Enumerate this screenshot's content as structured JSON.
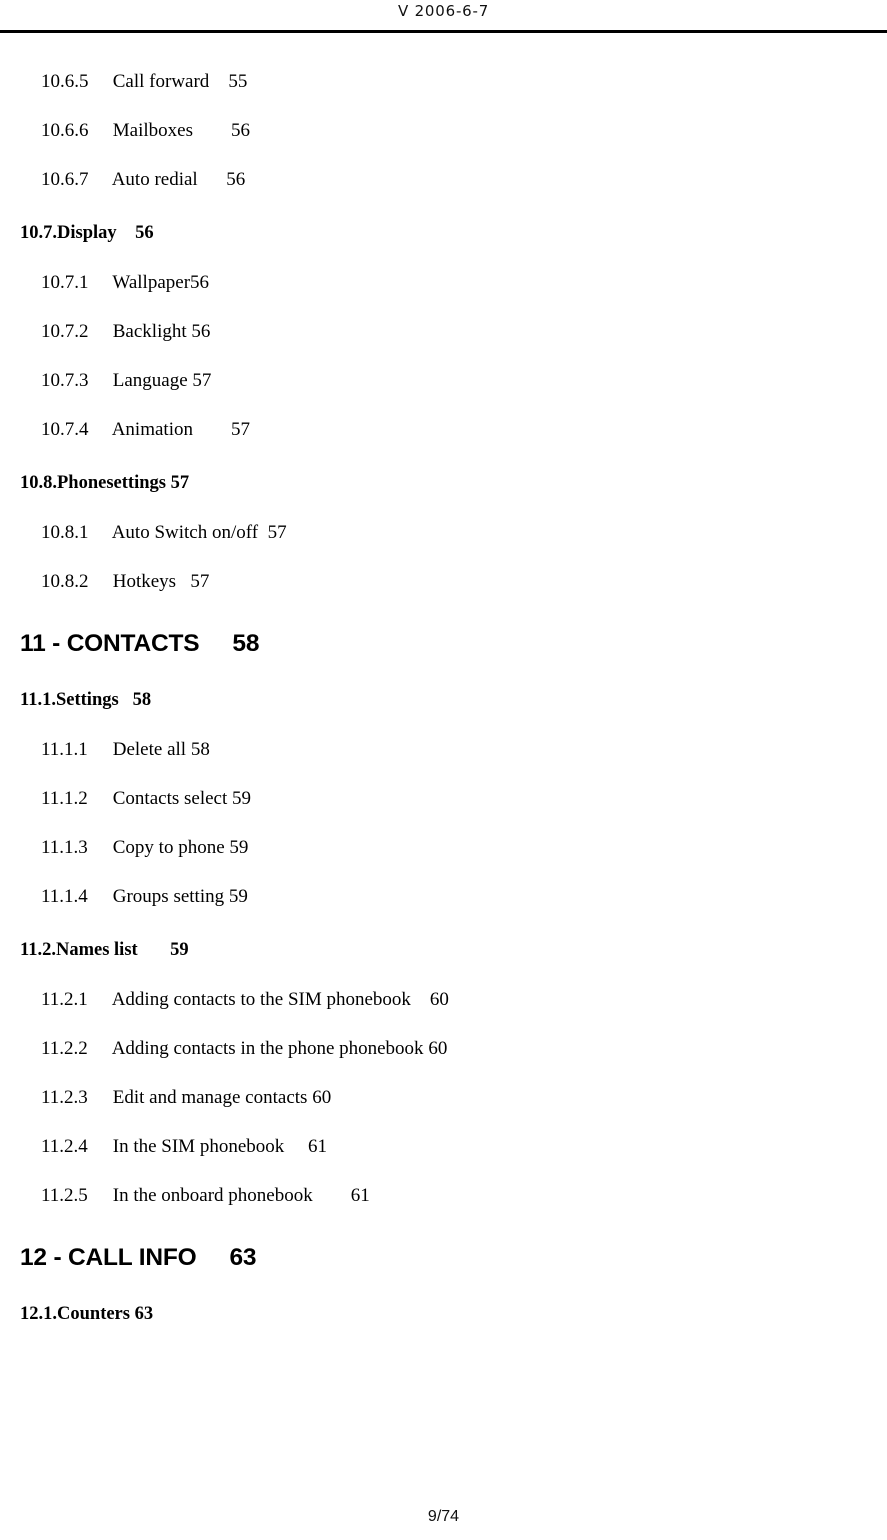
{
  "header": {
    "version_text": "V 2006-6-7"
  },
  "footer": {
    "page_number": "9/74"
  },
  "toc": {
    "entries": [
      {
        "level": 3,
        "num": "10.6.5",
        "title": "Call forward",
        "gap": "    ",
        "page": "55"
      },
      {
        "level": 3,
        "num": "10.6.6",
        "title": "Mailboxes",
        "gap": "        ",
        "page": "56"
      },
      {
        "level": 3,
        "num": "10.6.7",
        "title": "Auto redial",
        "gap": "      ",
        "page": "56"
      },
      {
        "level": 2,
        "num": "10.7.",
        "title": "Display",
        "gap": "    ",
        "page": "56"
      },
      {
        "level": 3,
        "num": "10.7.1",
        "title": "Wallpaper",
        "gap": "",
        "page": "56"
      },
      {
        "level": 3,
        "num": "10.7.2",
        "title": "Backlight",
        "gap": " ",
        "page": "56"
      },
      {
        "level": 3,
        "num": "10.7.3",
        "title": "Language",
        "gap": " ",
        "page": "57"
      },
      {
        "level": 3,
        "num": "10.7.4",
        "title": "Animation",
        "gap": "        ",
        "page": "57"
      },
      {
        "level": 2,
        "num": "10.8.",
        "title": "Phonesettings",
        "gap": " ",
        "page": "57"
      },
      {
        "level": 3,
        "num": "10.8.1",
        "title": "Auto Switch on/off",
        "gap": "  ",
        "page": "57"
      },
      {
        "level": 3,
        "num": "10.8.2",
        "title": "Hotkeys",
        "gap": "   ",
        "page": "57"
      },
      {
        "level": 1,
        "num": "11 -",
        "title": "CONTACTS",
        "gap": "     ",
        "page": "58"
      },
      {
        "level": 2,
        "num": "11.1.",
        "title": "Settings",
        "gap": "   ",
        "page": "58"
      },
      {
        "level": 3,
        "num": "11.1.1",
        "title": "Delete all",
        "gap": " ",
        "page": "58"
      },
      {
        "level": 3,
        "num": "11.1.2",
        "title": "Contacts select",
        "gap": " ",
        "page": "59"
      },
      {
        "level": 3,
        "num": "11.1.3",
        "title": "Copy to phone",
        "gap": " ",
        "page": "59"
      },
      {
        "level": 3,
        "num": "11.1.4",
        "title": "Groups setting",
        "gap": " ",
        "page": "59"
      },
      {
        "level": 2,
        "num": "11.2.",
        "title": "Names list",
        "gap": "       ",
        "page": "59"
      },
      {
        "level": 3,
        "num": "11.2.1",
        "title": "Adding contacts to the SIM phonebook",
        "gap": "    ",
        "page": "60"
      },
      {
        "level": 3,
        "num": "11.2.2",
        "title": "Adding contacts in the phone phonebook",
        "gap": " ",
        "page": "60"
      },
      {
        "level": 3,
        "num": "11.2.3",
        "title": "Edit and manage contacts",
        "gap": " ",
        "page": "60"
      },
      {
        "level": 3,
        "num": "11.2.4",
        "title": "In the SIM phonebook",
        "gap": "     ",
        "page": "61"
      },
      {
        "level": 3,
        "num": "11.2.5",
        "title": "In the onboard phonebook",
        "gap": "        ",
        "page": "61"
      },
      {
        "level": 1,
        "num": "12 -",
        "title": "CALL INFO",
        "gap": "     ",
        "page": "63"
      },
      {
        "level": 2,
        "num": "12.1.",
        "title": "Counters",
        "gap": " ",
        "page": "63"
      }
    ]
  }
}
